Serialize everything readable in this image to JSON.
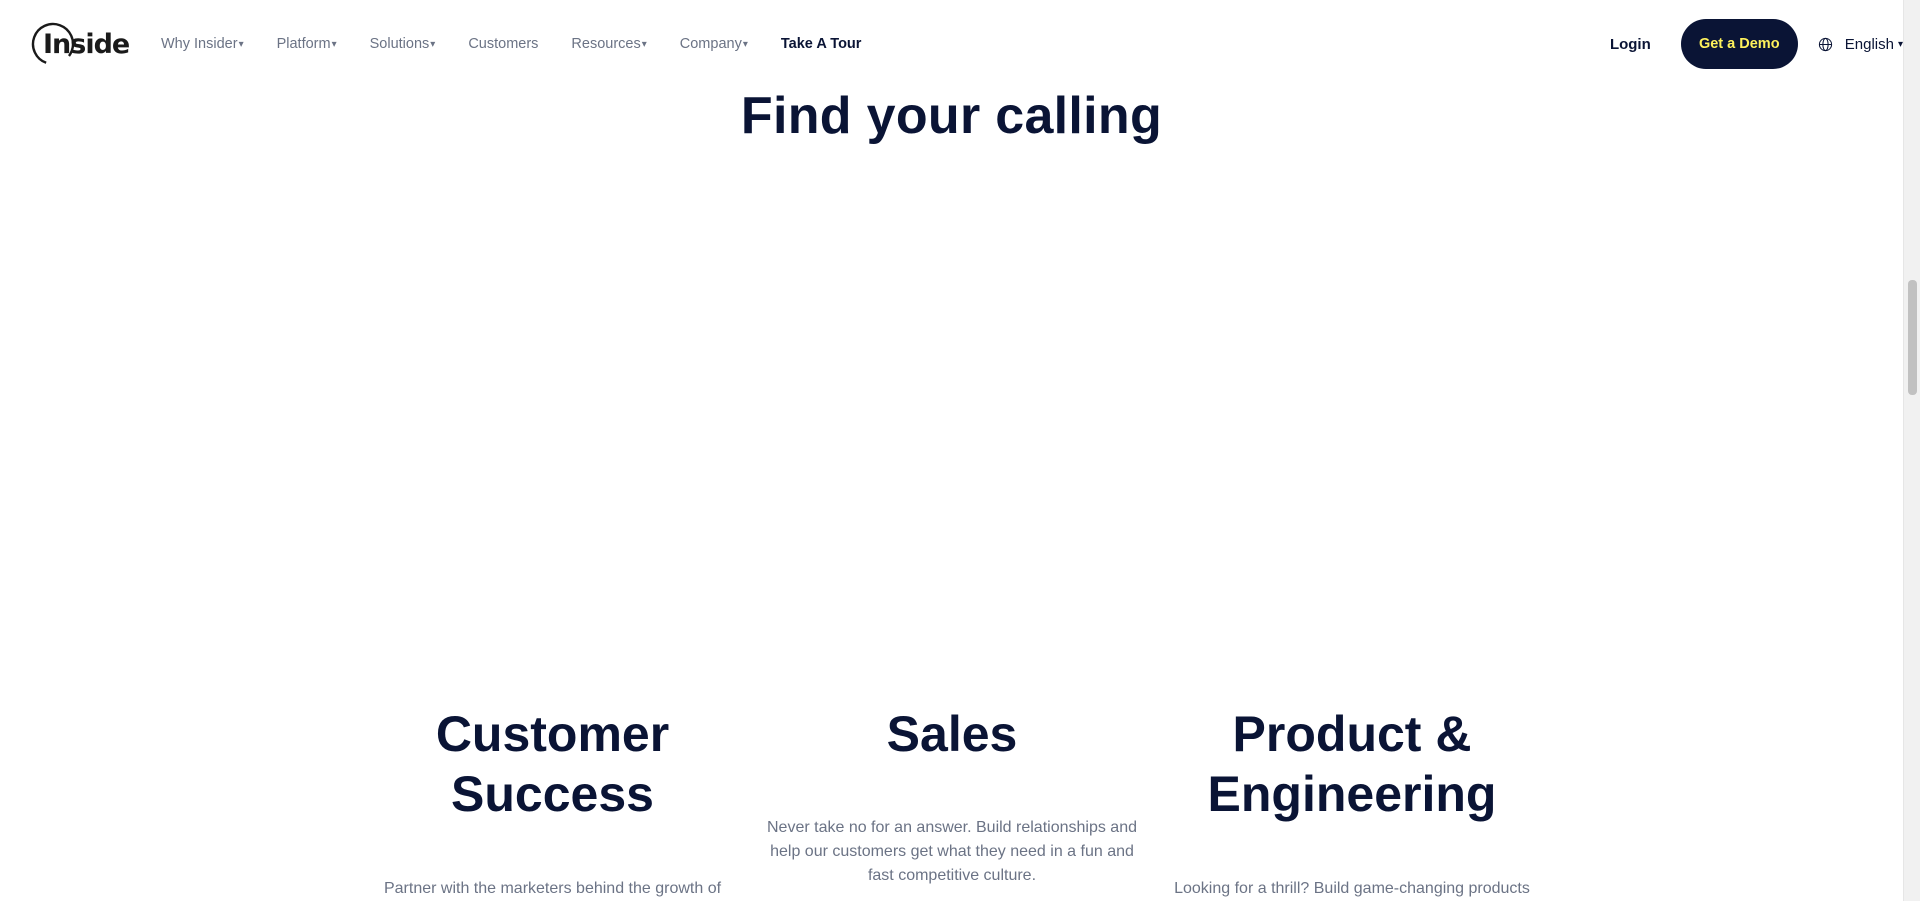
{
  "header": {
    "logo_text": "Insider",
    "nav": [
      {
        "label": "Why Insider",
        "caret": "▾"
      },
      {
        "label": "Platform",
        "caret": "▾"
      },
      {
        "label": "Solutions",
        "caret": "▾"
      },
      {
        "label": "Customers",
        "caret": ""
      },
      {
        "label": "Resources",
        "caret": "▾"
      },
      {
        "label": "Company",
        "caret": "▾"
      },
      {
        "label": "Take A Tour",
        "caret": ""
      }
    ],
    "login_label": "Login",
    "demo_label": "Get a Demo",
    "language_label": "English",
    "language_caret": "▾",
    "globe_icon": "globe-icon"
  },
  "main": {
    "title": "Find your calling",
    "columns": [
      {
        "heading_line1": "Customer",
        "heading_line2": "Success",
        "desc_line1": "Partner with the marketers behind the growth of"
      },
      {
        "heading_line1": "Sales",
        "desc_line1": "Never take no for an answer. Build relationships and",
        "desc_line2": "help our customers get what they need in a fun and",
        "desc_line3": "fast competitive culture."
      },
      {
        "heading_line1": "Product &",
        "heading_line2": "Engineering",
        "desc_line1": "Looking for a thrill? Build game-changing products"
      }
    ]
  },
  "colors": {
    "navy": "#0a1435",
    "demo_text": "#fff25c",
    "muted_text": "#6b7385"
  }
}
